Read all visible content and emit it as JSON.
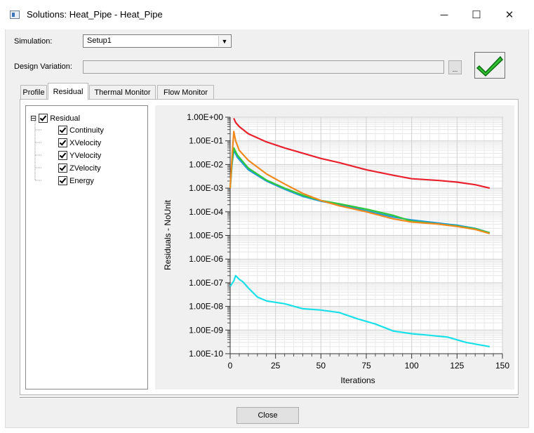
{
  "window": {
    "title": "Solutions: Heat_Pipe - Heat_Pipe",
    "minimize_glyph": "─",
    "maximize_glyph": "☐",
    "close_glyph": "✕"
  },
  "simulation": {
    "label": "Simulation:",
    "value": "Setup1"
  },
  "design_variation": {
    "label": "Design Variation:",
    "value": "",
    "browse_label": "..."
  },
  "tabs": [
    {
      "label": "Profile",
      "active": false
    },
    {
      "label": "Residual",
      "active": true
    },
    {
      "label": "Thermal Monitor",
      "active": false
    },
    {
      "label": "Flow Monitor",
      "active": false
    }
  ],
  "tree": {
    "expander": "⊟",
    "root": "Residual",
    "children": [
      "Continuity",
      "XVelocity",
      "YVelocity",
      "ZVelocity",
      "Energy"
    ]
  },
  "close_label": "Close",
  "colors": {
    "status_check": "#2fc12f",
    "continuity": "#e8212d",
    "xvelocity": "#1e9ad6",
    "yvelocity": "#32c83c",
    "zvelocity": "#f08a1e",
    "energy": "#19e0e8"
  },
  "chart_data": {
    "type": "line",
    "title": "",
    "xlabel": "Iterations",
    "ylabel": "Residuals - NoUnit",
    "log_y": true,
    "xlim": [
      0,
      150
    ],
    "ylim": [
      1e-10,
      1
    ],
    "x_ticks": [
      "0",
      "25",
      "50",
      "75",
      "100",
      "125",
      "150"
    ],
    "y_ticks": [
      "1.00E+00",
      "1.00E-01",
      "1.00E-02",
      "1.00E-03",
      "1.00E-04",
      "1.00E-05",
      "1.00E-06",
      "1.00E-07",
      "1.00E-08",
      "1.00E-09",
      "1.00E-10"
    ],
    "grid": true,
    "legend": "none",
    "series": [
      {
        "color": "#e8212d",
        "points": [
          [
            2,
            0.9
          ],
          [
            3,
            0.6
          ],
          [
            5,
            0.4
          ],
          [
            10,
            0.2
          ],
          [
            20,
            0.09
          ],
          [
            30,
            0.05
          ],
          [
            40,
            0.03
          ],
          [
            50,
            0.018
          ],
          [
            60,
            0.012
          ],
          [
            75,
            0.006
          ],
          [
            90,
            0.0035
          ],
          [
            100,
            0.0025
          ],
          [
            115,
            0.0021
          ],
          [
            125,
            0.0018
          ],
          [
            135,
            0.0014
          ],
          [
            143,
            0.001
          ]
        ]
      },
      {
        "color": "#1e9ad6",
        "points": [
          [
            0,
            0.001
          ],
          [
            1,
            0.01
          ],
          [
            2,
            0.04
          ],
          [
            4,
            0.02
          ],
          [
            10,
            0.006
          ],
          [
            20,
            0.002
          ],
          [
            30,
            0.0009
          ],
          [
            40,
            0.00045
          ],
          [
            50,
            0.00028
          ],
          [
            60,
            0.0002
          ],
          [
            75,
            0.00011
          ],
          [
            90,
            6e-05
          ],
          [
            100,
            4.5e-05
          ],
          [
            115,
            3.3e-05
          ],
          [
            125,
            2.7e-05
          ],
          [
            135,
            2e-05
          ],
          [
            143,
            1.3e-05
          ]
        ]
      },
      {
        "color": "#32c83c",
        "points": [
          [
            0,
            0.001
          ],
          [
            1,
            0.012
          ],
          [
            2,
            0.05
          ],
          [
            4,
            0.025
          ],
          [
            10,
            0.007
          ],
          [
            20,
            0.0022
          ],
          [
            30,
            0.001
          ],
          [
            40,
            0.0005
          ],
          [
            50,
            0.0003
          ],
          [
            60,
            0.00022
          ],
          [
            75,
            0.00013
          ],
          [
            90,
            7e-05
          ],
          [
            100,
            4e-05
          ],
          [
            115,
            3e-05
          ],
          [
            125,
            2.5e-05
          ],
          [
            135,
            1.9e-05
          ],
          [
            143,
            1.3e-05
          ]
        ]
      },
      {
        "color": "#f08a1e",
        "points": [
          [
            0,
            0.001
          ],
          [
            1,
            0.02
          ],
          [
            2,
            0.25
          ],
          [
            3,
            0.1
          ],
          [
            5,
            0.04
          ],
          [
            10,
            0.015
          ],
          [
            20,
            0.004
          ],
          [
            30,
            0.0015
          ],
          [
            40,
            0.0006
          ],
          [
            50,
            0.0003
          ],
          [
            60,
            0.00018
          ],
          [
            75,
            0.0001
          ],
          [
            90,
            5e-05
          ],
          [
            100,
            3.7e-05
          ],
          [
            115,
            3e-05
          ],
          [
            125,
            2.4e-05
          ],
          [
            135,
            1.8e-05
          ],
          [
            143,
            1.2e-05
          ]
        ]
      },
      {
        "color": "#19e0e8",
        "points": [
          [
            0,
            7e-08
          ],
          [
            2,
            1.2e-07
          ],
          [
            3,
            2e-07
          ],
          [
            5,
            1.4e-07
          ],
          [
            7,
            1.1e-07
          ],
          [
            10,
            6e-08
          ],
          [
            15,
            2.5e-08
          ],
          [
            20,
            1.7e-08
          ],
          [
            30,
            1.3e-08
          ],
          [
            40,
            8e-09
          ],
          [
            50,
            7e-09
          ],
          [
            60,
            5.5e-09
          ],
          [
            70,
            3e-09
          ],
          [
            80,
            1.8e-09
          ],
          [
            90,
            9e-10
          ],
          [
            100,
            7e-10
          ],
          [
            110,
            6e-10
          ],
          [
            120,
            5e-10
          ],
          [
            130,
            3e-10
          ],
          [
            143,
            2e-10
          ]
        ]
      }
    ]
  }
}
